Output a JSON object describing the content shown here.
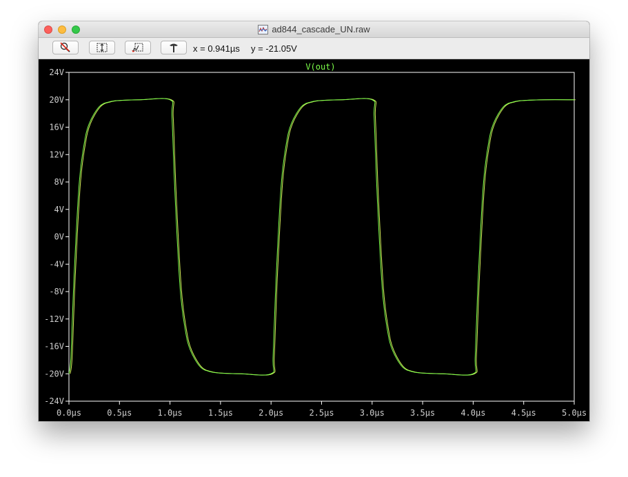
{
  "window": {
    "title": "ad844_cascade_UN.raw"
  },
  "toolbar": {
    "buttons": [
      {
        "icon": "zoom-cancel-icon"
      },
      {
        "icon": "autorange-icon"
      },
      {
        "icon": "zoom-back-icon"
      },
      {
        "icon": "probe-icon"
      }
    ],
    "cursor_x": "x = 0.941µs",
    "cursor_y": "y = -21.05V"
  },
  "colors": {
    "background": "#000000",
    "axis": "#ffffff",
    "trace": "#7dff4a",
    "trace2": "#d6f05a",
    "title": "#7dff4a"
  },
  "chart_data": {
    "type": "line",
    "title": "V(out)",
    "xlabel": "",
    "ylabel": "",
    "xlim": [
      0,
      5.0
    ],
    "ylim": [
      -24,
      24
    ],
    "xticks": [
      "0.0µs",
      "0.5µs",
      "1.0µs",
      "1.5µs",
      "2.0µs",
      "2.5µs",
      "3.0µs",
      "3.5µs",
      "4.0µs",
      "4.5µs",
      "5.0µs"
    ],
    "xtick_values": [
      0,
      0.5,
      1.0,
      1.5,
      2.0,
      2.5,
      3.0,
      3.5,
      4.0,
      4.5,
      5.0
    ],
    "yticks": [
      "24V",
      "20V",
      "16V",
      "12V",
      "8V",
      "4V",
      "0V",
      "-4V",
      "-8V",
      "-12V",
      "-16V",
      "-20V",
      "-24V"
    ],
    "ytick_values": [
      24,
      20,
      16,
      12,
      8,
      4,
      0,
      -4,
      -8,
      -12,
      -16,
      -20,
      -24
    ],
    "grid": false,
    "series": [
      {
        "values_desc": "output square wave response",
        "x": [
          0.0,
          0.02,
          0.05,
          0.1,
          0.15,
          0.2,
          0.3,
          0.4,
          0.5,
          0.7,
          1.0,
          1.02,
          1.05,
          1.1,
          1.15,
          1.2,
          1.3,
          1.4,
          1.5,
          1.7,
          2.0,
          2.02,
          2.05,
          2.1,
          2.15,
          2.2,
          2.3,
          2.4,
          2.5,
          2.7,
          3.0,
          3.02,
          3.05,
          3.1,
          3.15,
          3.2,
          3.3,
          3.4,
          3.5,
          3.7,
          4.0,
          4.02,
          4.05,
          4.1,
          4.15,
          4.2,
          4.3,
          4.4,
          4.5,
          4.7,
          5.0
        ],
        "y": [
          -20.0,
          -17.5,
          -6.0,
          7.5,
          13.5,
          16.5,
          19.0,
          19.7,
          19.9,
          20.0,
          20.0,
          17.5,
          6.0,
          -7.5,
          -13.5,
          -16.5,
          -19.0,
          -19.7,
          -19.9,
          -20.0,
          -20.0,
          -17.5,
          -6.0,
          7.5,
          13.5,
          16.5,
          19.0,
          19.7,
          19.9,
          20.0,
          20.0,
          17.5,
          6.0,
          -7.5,
          -13.5,
          -16.5,
          -19.0,
          -19.7,
          -19.9,
          -20.0,
          -20.0,
          -17.5,
          -6.0,
          7.5,
          13.5,
          16.5,
          19.0,
          19.7,
          19.9,
          20.0,
          20.0
        ]
      }
    ]
  }
}
